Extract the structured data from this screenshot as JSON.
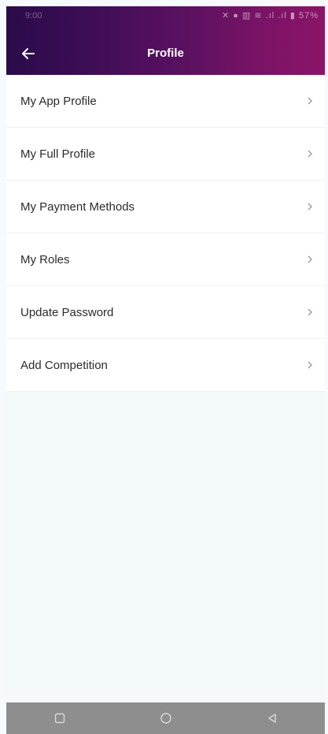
{
  "status_bar": {
    "time": "9:00",
    "icons_text": "✕ ● ▥ ≋ .ıl .ıl ▮ 57%",
    "battery": "57%"
  },
  "header": {
    "title": "Profile",
    "back_icon": "arrow-left-icon"
  },
  "menu": {
    "items": [
      {
        "label": "My App Profile"
      },
      {
        "label": "My Full Profile"
      },
      {
        "label": "My Payment Methods"
      },
      {
        "label": "My Roles"
      },
      {
        "label": "Update Password"
      },
      {
        "label": "Add Competition"
      }
    ],
    "chevron_icon": "chevron-right-icon"
  },
  "nav_bar": {
    "buttons": [
      "recents-icon",
      "home-icon",
      "back-triangle-icon"
    ]
  },
  "colors": {
    "appbar_start": "#2a0b4a",
    "appbar_end": "#8b1468",
    "background": "#f4f9fc",
    "nav_bar": "#8e8e8e"
  }
}
